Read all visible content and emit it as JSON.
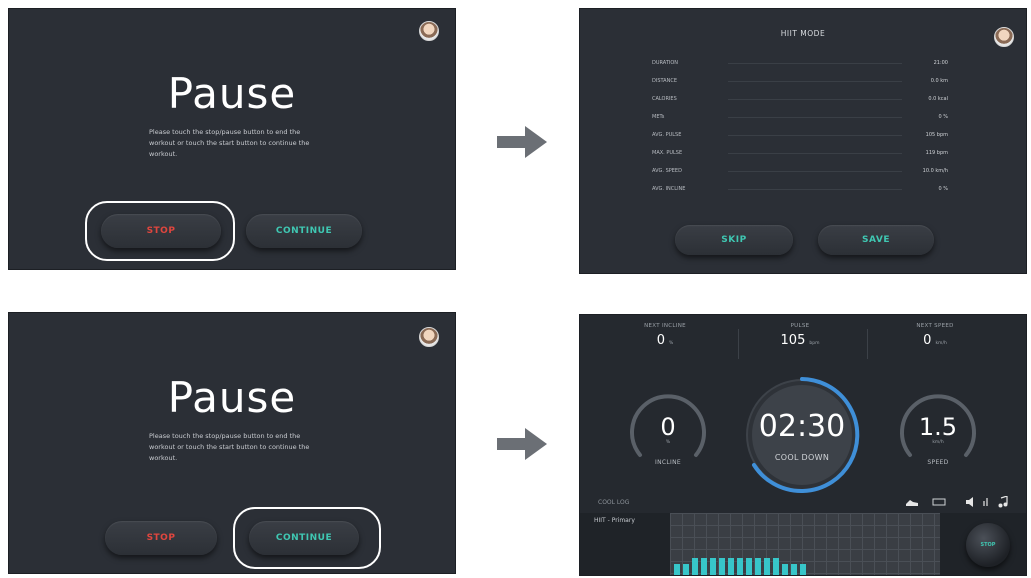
{
  "pause_screen": {
    "title": "Pause",
    "message": "Please touch the stop/pause button to end the workout or touch the start button to continue the workout.",
    "stop_label": "STOP",
    "continue_label": "CONTINUE"
  },
  "summary_screen": {
    "title": "HIIT MODE",
    "rows": [
      {
        "label": "DURATION",
        "value": "21:00"
      },
      {
        "label": "DISTANCE",
        "value": "0.0 km"
      },
      {
        "label": "CALORIES",
        "value": "0.0 kcal"
      },
      {
        "label": "METs",
        "value": "0 %"
      },
      {
        "label": "AVG. PULSE",
        "value": "105 bpm"
      },
      {
        "label": "MAX. PULSE",
        "value": "119 bpm"
      },
      {
        "label": "AVG. SPEED",
        "value": "10.0 km/h"
      },
      {
        "label": "AVG. INCLINE",
        "value": "0 %"
      }
    ],
    "skip_label": "SKIP",
    "save_label": "SAVE"
  },
  "workout_screen": {
    "next_incline_label": "NEXT INCLINE",
    "next_incline_value": "0",
    "next_incline_unit": "%",
    "pulse_label": "PULSE",
    "pulse_value": "105",
    "pulse_unit": "bpm",
    "next_speed_label": "NEXT SPEED",
    "next_speed_value": "0",
    "next_speed_unit": "km/h",
    "incline_value": "0",
    "incline_unit": "%",
    "incline_label": "INCLINE",
    "timer_value": "02:30",
    "timer_label": "COOL DOWN",
    "speed_value": "1.5",
    "speed_unit": "km/h",
    "speed_label": "SPEED",
    "bottom_left_label": "COOL LOG",
    "chart_label": "HIIT - Primary",
    "stop_knob_label": "STOP",
    "bar_levels": [
      0.2,
      0.2,
      0.3,
      0.3,
      0.3,
      0.3,
      0.3,
      0.3,
      0.3,
      0.3,
      0.3,
      0.3,
      0.2,
      0.2,
      0.2
    ]
  },
  "colors": {
    "stop_red": "#e0463e",
    "continue_teal": "#3fc7b2",
    "screen_bg": "#2b2f36",
    "chart_bar": "#37c6c9",
    "timer_ring": "#3f8fd8"
  },
  "icons": [
    "avatar",
    "arrow-right-icon",
    "shoe-icon",
    "volume-icon",
    "music-icon"
  ]
}
